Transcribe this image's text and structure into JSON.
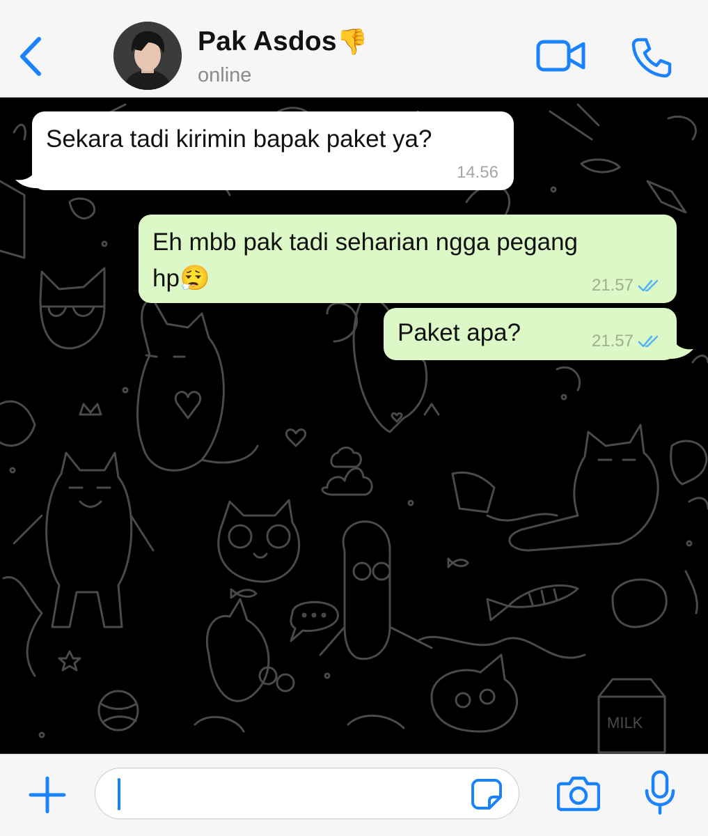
{
  "header": {
    "contact_name": "Pak Asdos",
    "name_emoji": "👎",
    "status": "online"
  },
  "messages": [
    {
      "direction": "incoming",
      "text": "Sekara tadi kirimin bapak paket ya?",
      "time": "14.56"
    },
    {
      "direction": "outgoing",
      "line1": "Eh mbb pak tadi seharian ngga pegang",
      "line2": "hp",
      "emoji": "😮‍💨",
      "time": "21.57",
      "receipt": "read"
    },
    {
      "direction": "outgoing",
      "text": "Paket apa?",
      "time": "21.57",
      "receipt": "read"
    }
  ],
  "input": {
    "placeholder": "",
    "value": ""
  },
  "wallpaper": {
    "milk_label": "MILK"
  },
  "colors": {
    "accent": "#1a82fb",
    "incoming_bubble": "#ffffff",
    "outgoing_bubble": "#dcf8c6",
    "chat_background": "#000000",
    "read_receipt": "#4fb3f6"
  },
  "icons": {
    "back": "chevron-left-icon",
    "video": "video-camera-icon",
    "call": "phone-icon",
    "attach": "plus-icon",
    "sticker": "sticker-icon",
    "camera": "camera-icon",
    "mic": "microphone-icon"
  }
}
